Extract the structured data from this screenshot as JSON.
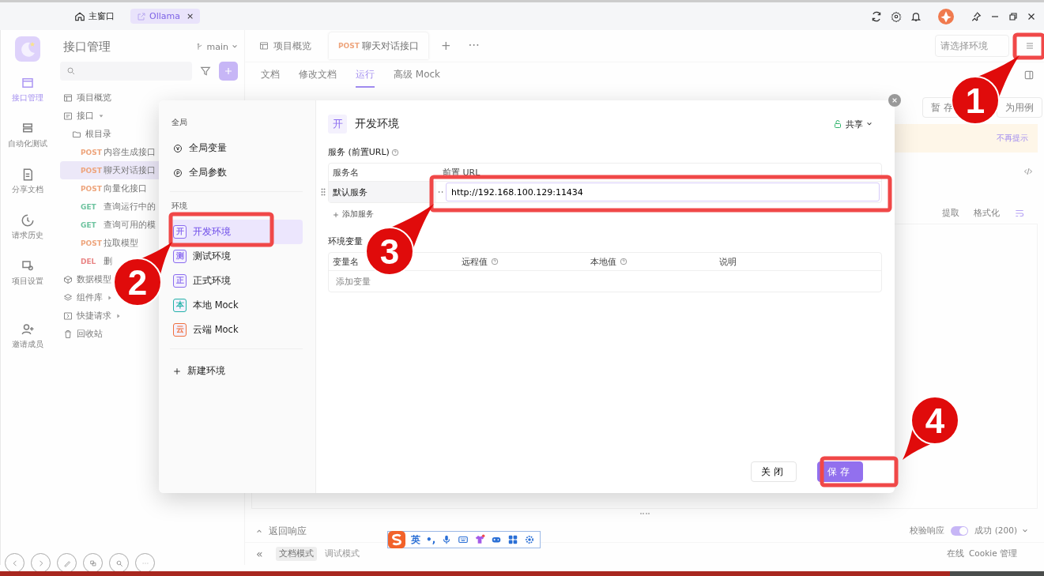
{
  "titlebar": {
    "tabs": [
      {
        "kind": "home",
        "label": "主窗口",
        "selected": false
      },
      {
        "kind": "project",
        "label": "Ollama",
        "selected": true,
        "close": "×"
      }
    ]
  },
  "rail": {
    "items": [
      {
        "label": "接口管理",
        "selected": true
      },
      {
        "label": "自动化测试",
        "selected": false
      },
      {
        "label": "分享文档",
        "selected": false
      },
      {
        "label": "请求历史",
        "selected": false
      },
      {
        "label": "项目设置",
        "selected": false
      },
      {
        "label": "邀请成员",
        "selected": false
      }
    ]
  },
  "sidebar": {
    "title": "接口管理",
    "branch": "main",
    "tree": [
      {
        "kind": "overview",
        "label": "项目概览"
      },
      {
        "kind": "group",
        "label": "接口",
        "expanded": true,
        "children": [
          {
            "kind": "folder",
            "label": "根目录",
            "children": [
              {
                "kind": "api",
                "method": "POST",
                "label": "内容生成接口",
                "selected": false
              },
              {
                "kind": "api",
                "method": "POST",
                "label": "聊天对话接口",
                "selected": true
              },
              {
                "kind": "api",
                "method": "POST",
                "label": "向量化接口",
                "selected": false
              },
              {
                "kind": "api",
                "method": "GET",
                "label": "查询运行中的",
                "selected": false
              },
              {
                "kind": "api",
                "method": "GET",
                "label": "查询可用的模",
                "selected": false
              },
              {
                "kind": "api",
                "method": "POST",
                "label": "拉取模型",
                "selected": false
              },
              {
                "kind": "api",
                "method": "DEL",
                "label": "删",
                "selected": false
              }
            ]
          }
        ]
      },
      {
        "kind": "models",
        "label": "数据模型"
      },
      {
        "kind": "components",
        "label": "组件库",
        "expanded": false
      },
      {
        "kind": "quick",
        "label": "快捷请求",
        "expanded": false
      },
      {
        "kind": "trash",
        "label": "回收站"
      }
    ]
  },
  "main": {
    "tabs": [
      {
        "kind": "overview",
        "label": "项目概览",
        "selected": false
      },
      {
        "kind": "api",
        "method": "POST",
        "label": "聊天对话接口",
        "selected": true
      }
    ],
    "add_tab": "+",
    "more_tabs": "···",
    "env_select": {
      "placeholder": "请选择环境"
    },
    "subtabs": [
      {
        "label": "文档",
        "selected": false
      },
      {
        "label": "修改文档",
        "selected": false
      },
      {
        "label": "运行",
        "selected": true
      },
      {
        "label": "高级 Mock",
        "selected": false
      }
    ],
    "actions": [
      "暂 存",
      "为用例"
    ],
    "notice": {
      "dismiss": "不再提示"
    },
    "tools": [
      "提取",
      "格式化"
    ],
    "response": {
      "title": "返回响应",
      "validate": {
        "label": "校验响应",
        "on": true
      },
      "status": "成功 (200)"
    },
    "bottom": {
      "collapse": "«",
      "modes": [
        {
          "label": "文档模式",
          "selected": true
        },
        {
          "label": "调试模式",
          "selected": false
        }
      ],
      "status": [
        "在线",
        "Cookie 管理"
      ]
    }
  },
  "modal": {
    "nav": {
      "global_heading": "全局",
      "global": [
        {
          "kind": "variables",
          "label": "全局变量"
        },
        {
          "kind": "params",
          "label": "全局参数"
        }
      ],
      "env_heading": "环境",
      "envs": [
        {
          "badge": "开",
          "label": "开发环境",
          "color": "#8b6cf0",
          "selected": true
        },
        {
          "badge": "测",
          "label": "测试环境",
          "color": "#8b6cf0",
          "selected": false
        },
        {
          "badge": "正",
          "label": "正式环境",
          "color": "#8b6cf0",
          "selected": false
        },
        {
          "badge": "本",
          "label": "本地 Mock",
          "color": "#22b3a8",
          "selected": false
        },
        {
          "badge": "云",
          "label": "云端 Mock",
          "color": "#f0703c",
          "selected": false
        }
      ],
      "new_env": "新建环境"
    },
    "header": {
      "badge": "开",
      "title": "开发环境",
      "share": "共享"
    },
    "services": {
      "title": "服务 (前置URL)",
      "columns": [
        "服务名",
        "前置 URL"
      ],
      "rows": [
        {
          "name": "默认服务",
          "url": "http://192.168.100.129:11434"
        }
      ],
      "add": "添加服务"
    },
    "variables": {
      "title": "环境变量",
      "columns": [
        {
          "label": "变量名",
          "help": false
        },
        {
          "label": "远程值",
          "help": true
        },
        {
          "label": "本地值",
          "help": true
        },
        {
          "label": "说明",
          "help": false
        }
      ],
      "placeholder": "添加变量"
    },
    "buttons": [
      {
        "kind": "secondary",
        "label": "关闭"
      },
      {
        "kind": "primary",
        "label": "保存"
      }
    ]
  },
  "annotations": [
    {
      "number": "1"
    },
    {
      "number": "2"
    },
    {
      "number": "3"
    },
    {
      "number": "4"
    }
  ],
  "ime": {
    "mode": "英",
    "punct": "•,"
  },
  "player": {
    "level": 0.91
  }
}
